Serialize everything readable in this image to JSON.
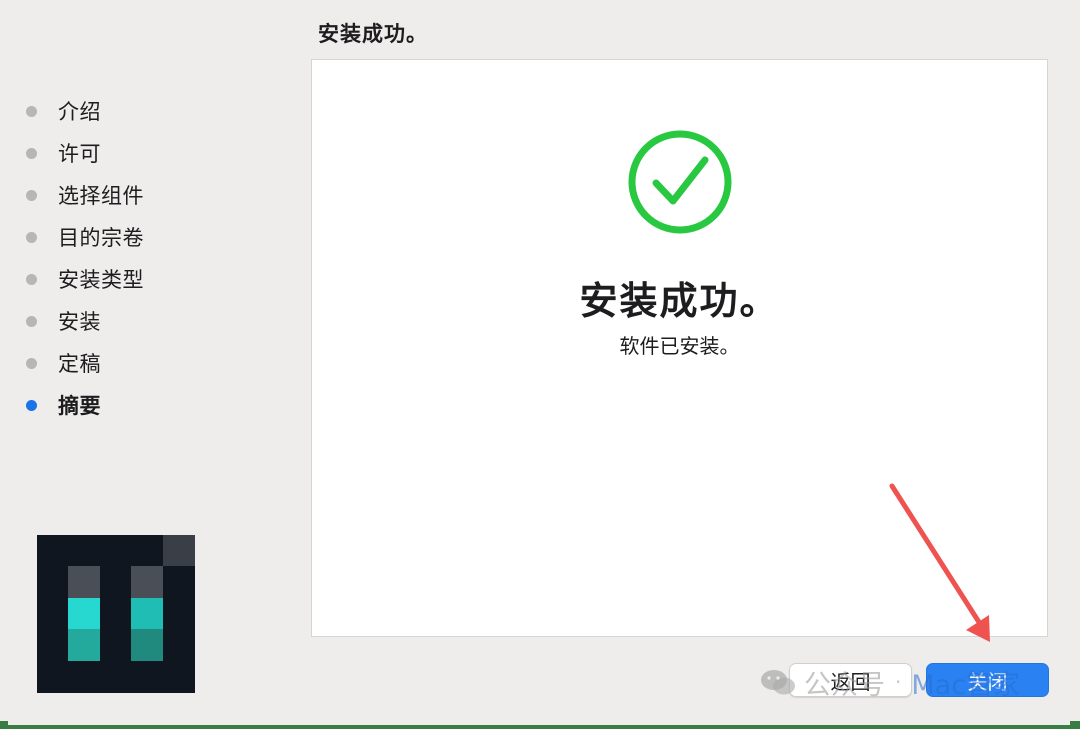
{
  "header": {
    "title": "安装成功。"
  },
  "sidebar": {
    "steps": [
      {
        "label": "介绍",
        "state": "done"
      },
      {
        "label": "许可",
        "state": "done"
      },
      {
        "label": "选择组件",
        "state": "done"
      },
      {
        "label": "目的宗卷",
        "state": "done"
      },
      {
        "label": "安装类型",
        "state": "done"
      },
      {
        "label": "安装",
        "state": "done"
      },
      {
        "label": "定稿",
        "state": "done"
      },
      {
        "label": "摘要",
        "state": "active"
      }
    ]
  },
  "main": {
    "success_title": "安装成功。",
    "success_desc": "软件已安装。",
    "icon": "checkmark-circle-icon"
  },
  "buttons": {
    "back_label": "返回",
    "close_label": "关闭"
  },
  "watermark": {
    "text": "公众号",
    "sep": "·",
    "brand": "Mac管家"
  },
  "colors": {
    "accent": "#2a82f2",
    "success": "#28c840",
    "arrow": "#ef5350",
    "inactive_dot": "#b6b6b6",
    "active_dot": "#1a73e8"
  }
}
